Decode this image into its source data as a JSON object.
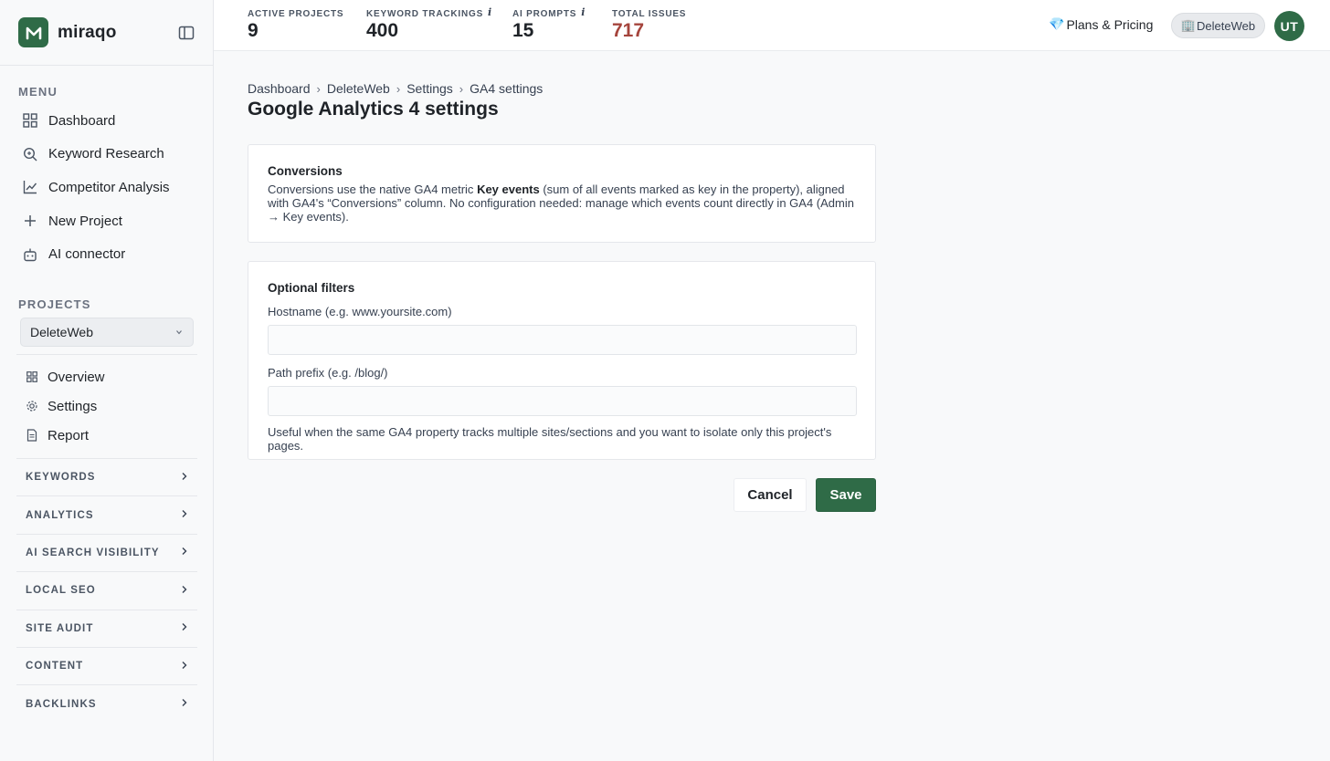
{
  "brand": {
    "name": "miraqo"
  },
  "sidebar": {
    "menu_label": "MENU",
    "items": [
      {
        "label": "Dashboard"
      },
      {
        "label": "Keyword Research"
      },
      {
        "label": "Competitor Analysis"
      },
      {
        "label": "New Project"
      },
      {
        "label": "AI connector"
      }
    ],
    "projects_label": "PROJECTS",
    "selected_project": "DeleteWeb",
    "project_items": [
      {
        "label": "Overview"
      },
      {
        "label": "Settings"
      },
      {
        "label": "Report"
      }
    ],
    "groups": [
      {
        "label": "KEYWORDS"
      },
      {
        "label": "ANALYTICS"
      },
      {
        "label": "AI SEARCH VISIBILITY"
      },
      {
        "label": "LOCAL SEO"
      },
      {
        "label": "SITE AUDIT"
      },
      {
        "label": "CONTENT"
      },
      {
        "label": "BACKLINKS"
      }
    ]
  },
  "topbar": {
    "stats": [
      {
        "label": "ACTIVE PROJECTS",
        "value": "9",
        "info": ""
      },
      {
        "label": "KEYWORD TRACKINGS",
        "value": "400",
        "info": "i"
      },
      {
        "label": "AI PROMPTS",
        "value": "15",
        "info": "i"
      },
      {
        "label": "TOTAL ISSUES",
        "value": "717",
        "info": ""
      }
    ],
    "pricing_icon": "💎",
    "pricing_label": "Plans & Pricing",
    "project_chip_icon": "🏢",
    "project_chip": "DeleteWeb",
    "avatar_initials": "UT"
  },
  "breadcrumb": [
    "Dashboard",
    "DeleteWeb",
    "Settings",
    "GA4 settings"
  ],
  "page_title": "Google Analytics 4 settings",
  "conversions": {
    "title": "Conversions",
    "text_before": "Conversions use the native GA4 metric ",
    "text_bold": "Key events",
    "text_after": " (sum of all events marked as key in the property), aligned with GA4's “Conversions” column. No configuration needed: manage which events count directly in GA4 (Admin → Key events)."
  },
  "filters": {
    "title": "Optional filters",
    "hostname_label": "Hostname (e.g. www.yoursite.com)",
    "hostname_value": "",
    "path_label": "Path prefix (e.g. /blog/)",
    "path_value": "",
    "help": "Useful when the same GA4 property tracks multiple sites/sections and you want to isolate only this project's pages."
  },
  "actions": {
    "cancel": "Cancel",
    "save": "Save"
  },
  "colors": {
    "brand": "#2f6b47",
    "danger": "#a5443c"
  }
}
